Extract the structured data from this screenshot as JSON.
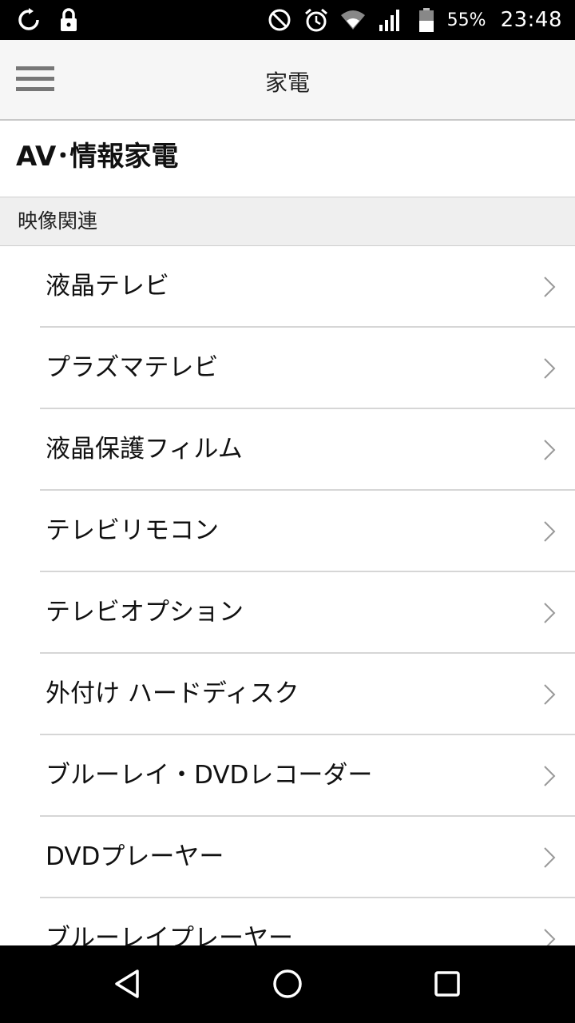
{
  "status_bar": {
    "battery_percent": "55%",
    "time": "23:48",
    "icons": [
      "sync-icon",
      "lock-icon",
      "do-not-disturb-icon",
      "alarm-icon",
      "wifi-icon",
      "signal-icon",
      "battery-icon"
    ]
  },
  "app_bar": {
    "title": "家電",
    "menu_icon": "hamburger-menu-icon"
  },
  "category": {
    "title": "AV･情報家電"
  },
  "section": {
    "title": "映像関連"
  },
  "items": [
    {
      "label": "液晶テレビ"
    },
    {
      "label": "プラズマテレビ"
    },
    {
      "label": "液晶保護フィルム"
    },
    {
      "label": "テレビリモコン"
    },
    {
      "label": "テレビオプション"
    },
    {
      "label": "外付け ハードディスク"
    },
    {
      "label": "ブルーレイ・DVDレコーダー"
    },
    {
      "label": "DVDプレーヤー"
    },
    {
      "label": "ブルーレイプレーヤー"
    }
  ],
  "nav_bar": {
    "icons": [
      "back-icon",
      "home-icon",
      "recent-apps-icon"
    ]
  }
}
